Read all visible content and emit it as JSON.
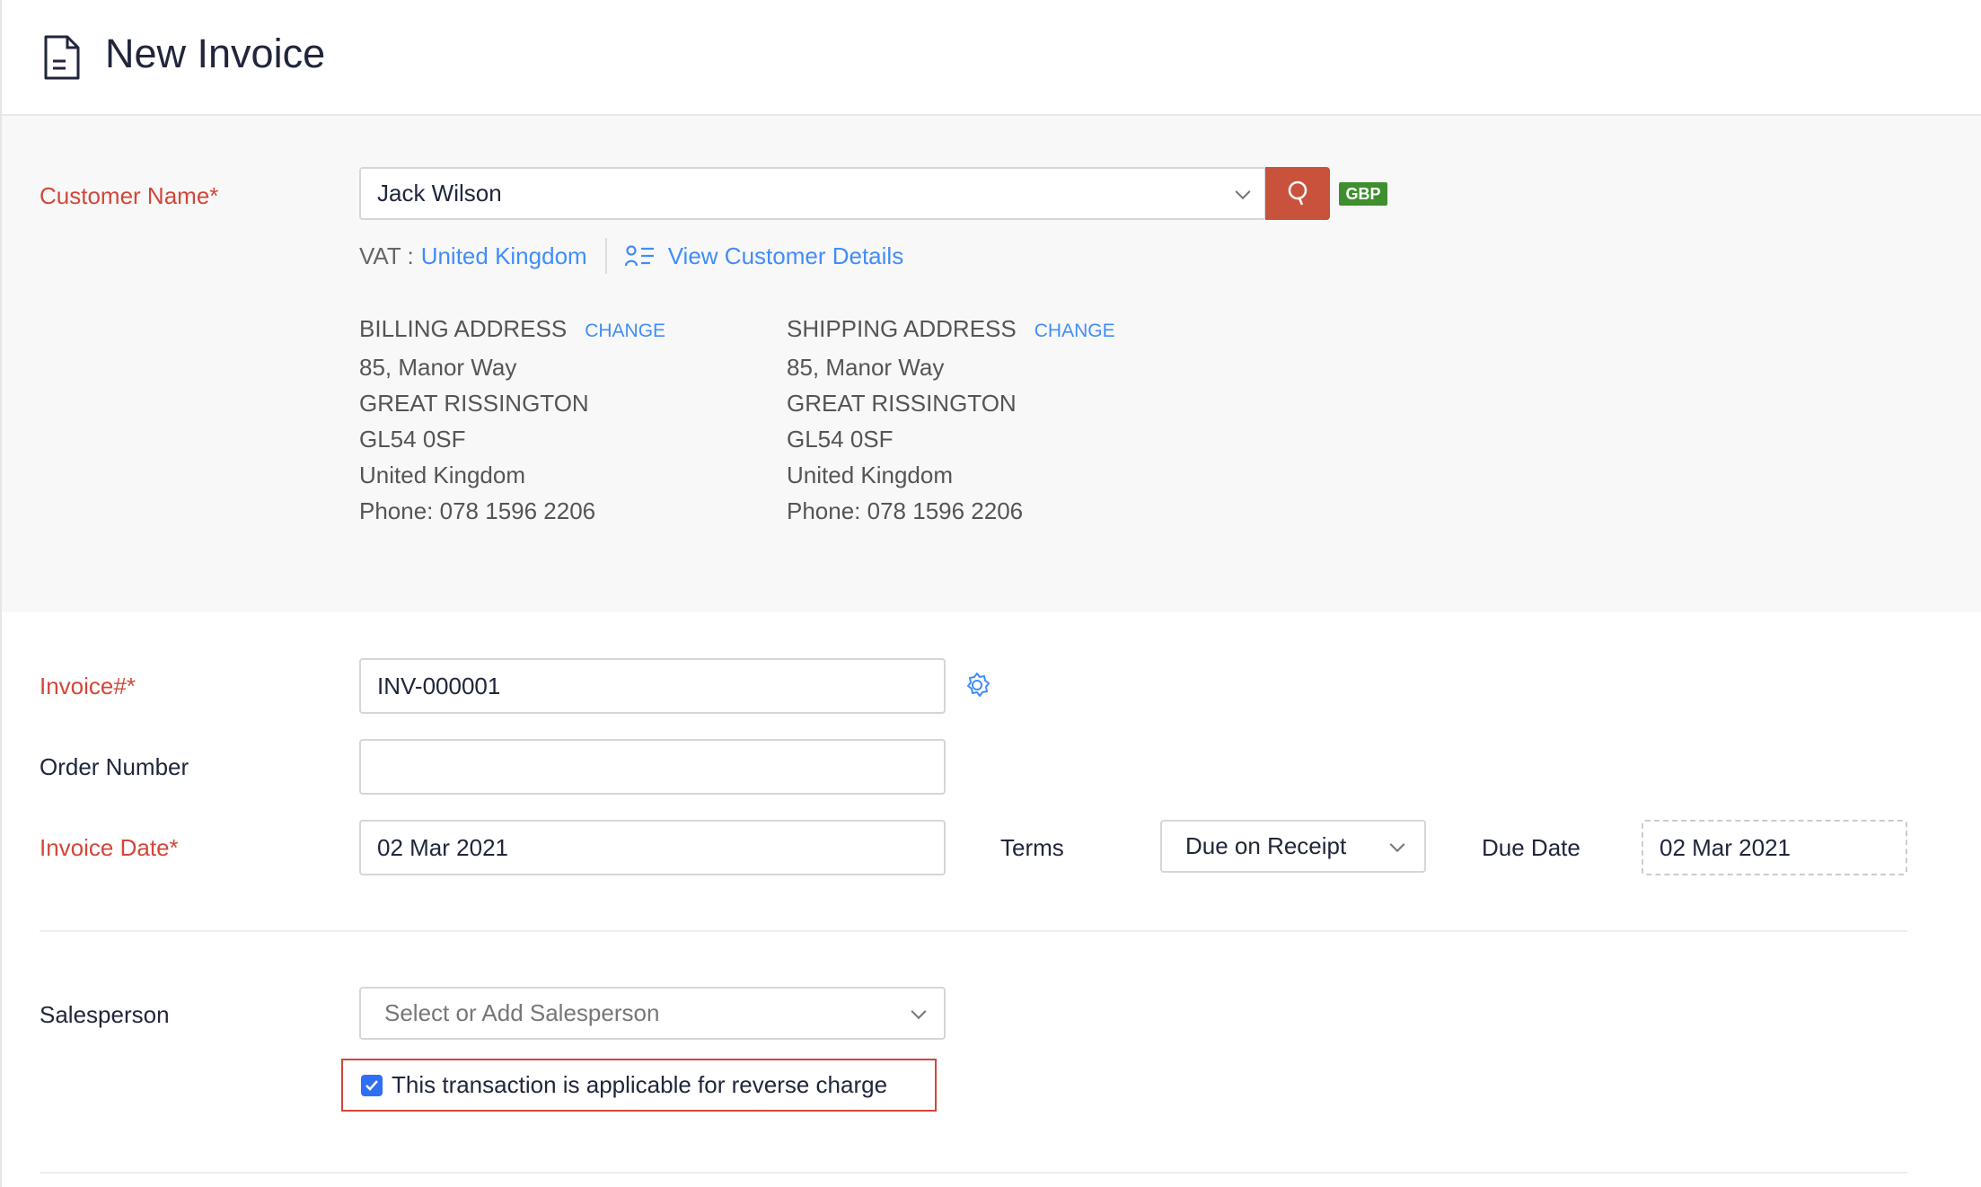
{
  "header": {
    "title": "New Invoice",
    "icon": "document-icon"
  },
  "customer": {
    "label": "Customer Name*",
    "value": "Jack Wilson",
    "currency": "GBP",
    "vat_label": "VAT :",
    "vat_value": "United Kingdom",
    "view_details": "View Customer Details",
    "billing": {
      "title": "BILLING ADDRESS",
      "change": "CHANGE",
      "lines": [
        "85,  Manor Way",
        "GREAT RISSINGTON",
        "GL54 0SF",
        "United Kingdom",
        "Phone: 078 1596 2206"
      ]
    },
    "shipping": {
      "title": "SHIPPING ADDRESS",
      "change": "CHANGE",
      "lines": [
        "85,  Manor Way",
        "GREAT RISSINGTON",
        "GL54 0SF",
        "United Kingdom",
        "Phone: 078 1596 2206"
      ]
    }
  },
  "invoice": {
    "number_label": "Invoice#*",
    "number_value": "INV-000001",
    "order_label": "Order Number",
    "order_value": "",
    "date_label": "Invoice Date*",
    "date_value": "02 Mar 2021",
    "terms_label": "Terms",
    "terms_value": "Due on Receipt",
    "due_label": "Due Date",
    "due_value": "02 Mar 2021"
  },
  "salesperson": {
    "label": "Salesperson",
    "placeholder": "Select or Add Salesperson"
  },
  "reverse_charge": {
    "label": "This transaction is applicable for reverse charge",
    "checked": true
  },
  "colors": {
    "accent": "#408dfb",
    "required": "#d2473a",
    "search_button": "#c9523d",
    "currency_badge": "#3f8f2f"
  }
}
